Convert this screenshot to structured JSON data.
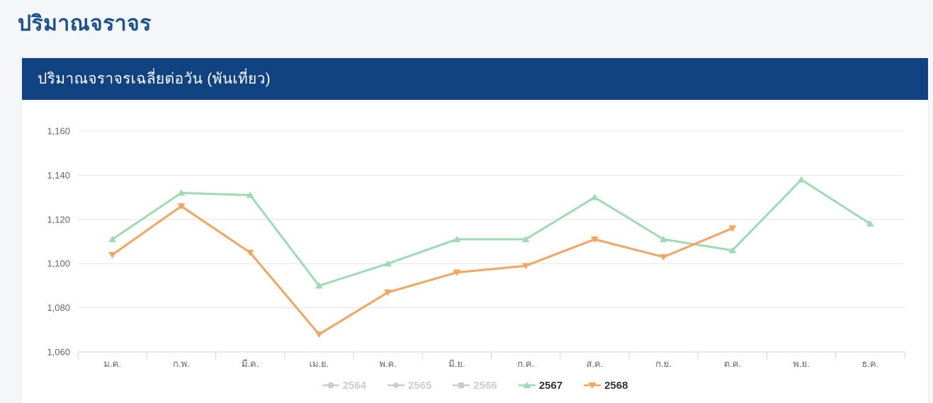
{
  "page": {
    "title": "ปริมาณจราจร"
  },
  "card": {
    "header": "ปริมาณจราจรเฉลี่ยต่อวัน (พันเที่ยว)"
  },
  "colors": {
    "page_background": "#f5f6f7",
    "page_title": "#1a5193",
    "card_header_background": "#114281",
    "card_header_text": "#ffffff",
    "gridline": "#e6e6e6",
    "axis_line": "#ccd6eb",
    "axis_label": "#666666",
    "legend_disabled": "#cccccc",
    "legend_active_text": "#333333",
    "series_2567": "#9bdcb3",
    "series_2568": "#f7a35c"
  },
  "chart_data": {
    "type": "line",
    "title": "ปริมาณจราจรเฉลี่ยต่อวัน (พันเที่ยว)",
    "categories": [
      "ม.ค.",
      "ก.พ.",
      "มี.ค.",
      "เม.ย.",
      "พ.ค.",
      "มิ.ย.",
      "ก.ค.",
      "ส.ค.",
      "ก.ย.",
      "ต.ค.",
      "พ.ย.",
      "ธ.ค."
    ],
    "xlabel": "",
    "ylabel": "",
    "ylim": [
      1060,
      1160
    ],
    "y_ticks": [
      "1,060",
      "1,080",
      "1,100",
      "1,120",
      "1,140",
      "1,160"
    ],
    "grid": true,
    "legend_position": "bottom",
    "series": [
      {
        "name": "2564",
        "visible": false,
        "marker": "circle",
        "color": "#cccccc",
        "values": []
      },
      {
        "name": "2565",
        "visible": false,
        "marker": "diamond",
        "color": "#cccccc",
        "values": []
      },
      {
        "name": "2566",
        "visible": false,
        "marker": "square",
        "color": "#cccccc",
        "values": []
      },
      {
        "name": "2567",
        "visible": true,
        "marker": "triangle-up",
        "color": "#9bdcb3",
        "values": [
          1111,
          1132,
          1131,
          1090,
          1100,
          1111,
          1111,
          1130,
          1111,
          1106,
          1138,
          1118
        ]
      },
      {
        "name": "2568",
        "visible": true,
        "marker": "triangle-down",
        "color": "#f7a35c",
        "values": [
          1104,
          1126,
          1105,
          1068,
          1087,
          1096,
          1099,
          1111,
          1103,
          1116
        ]
      }
    ]
  }
}
